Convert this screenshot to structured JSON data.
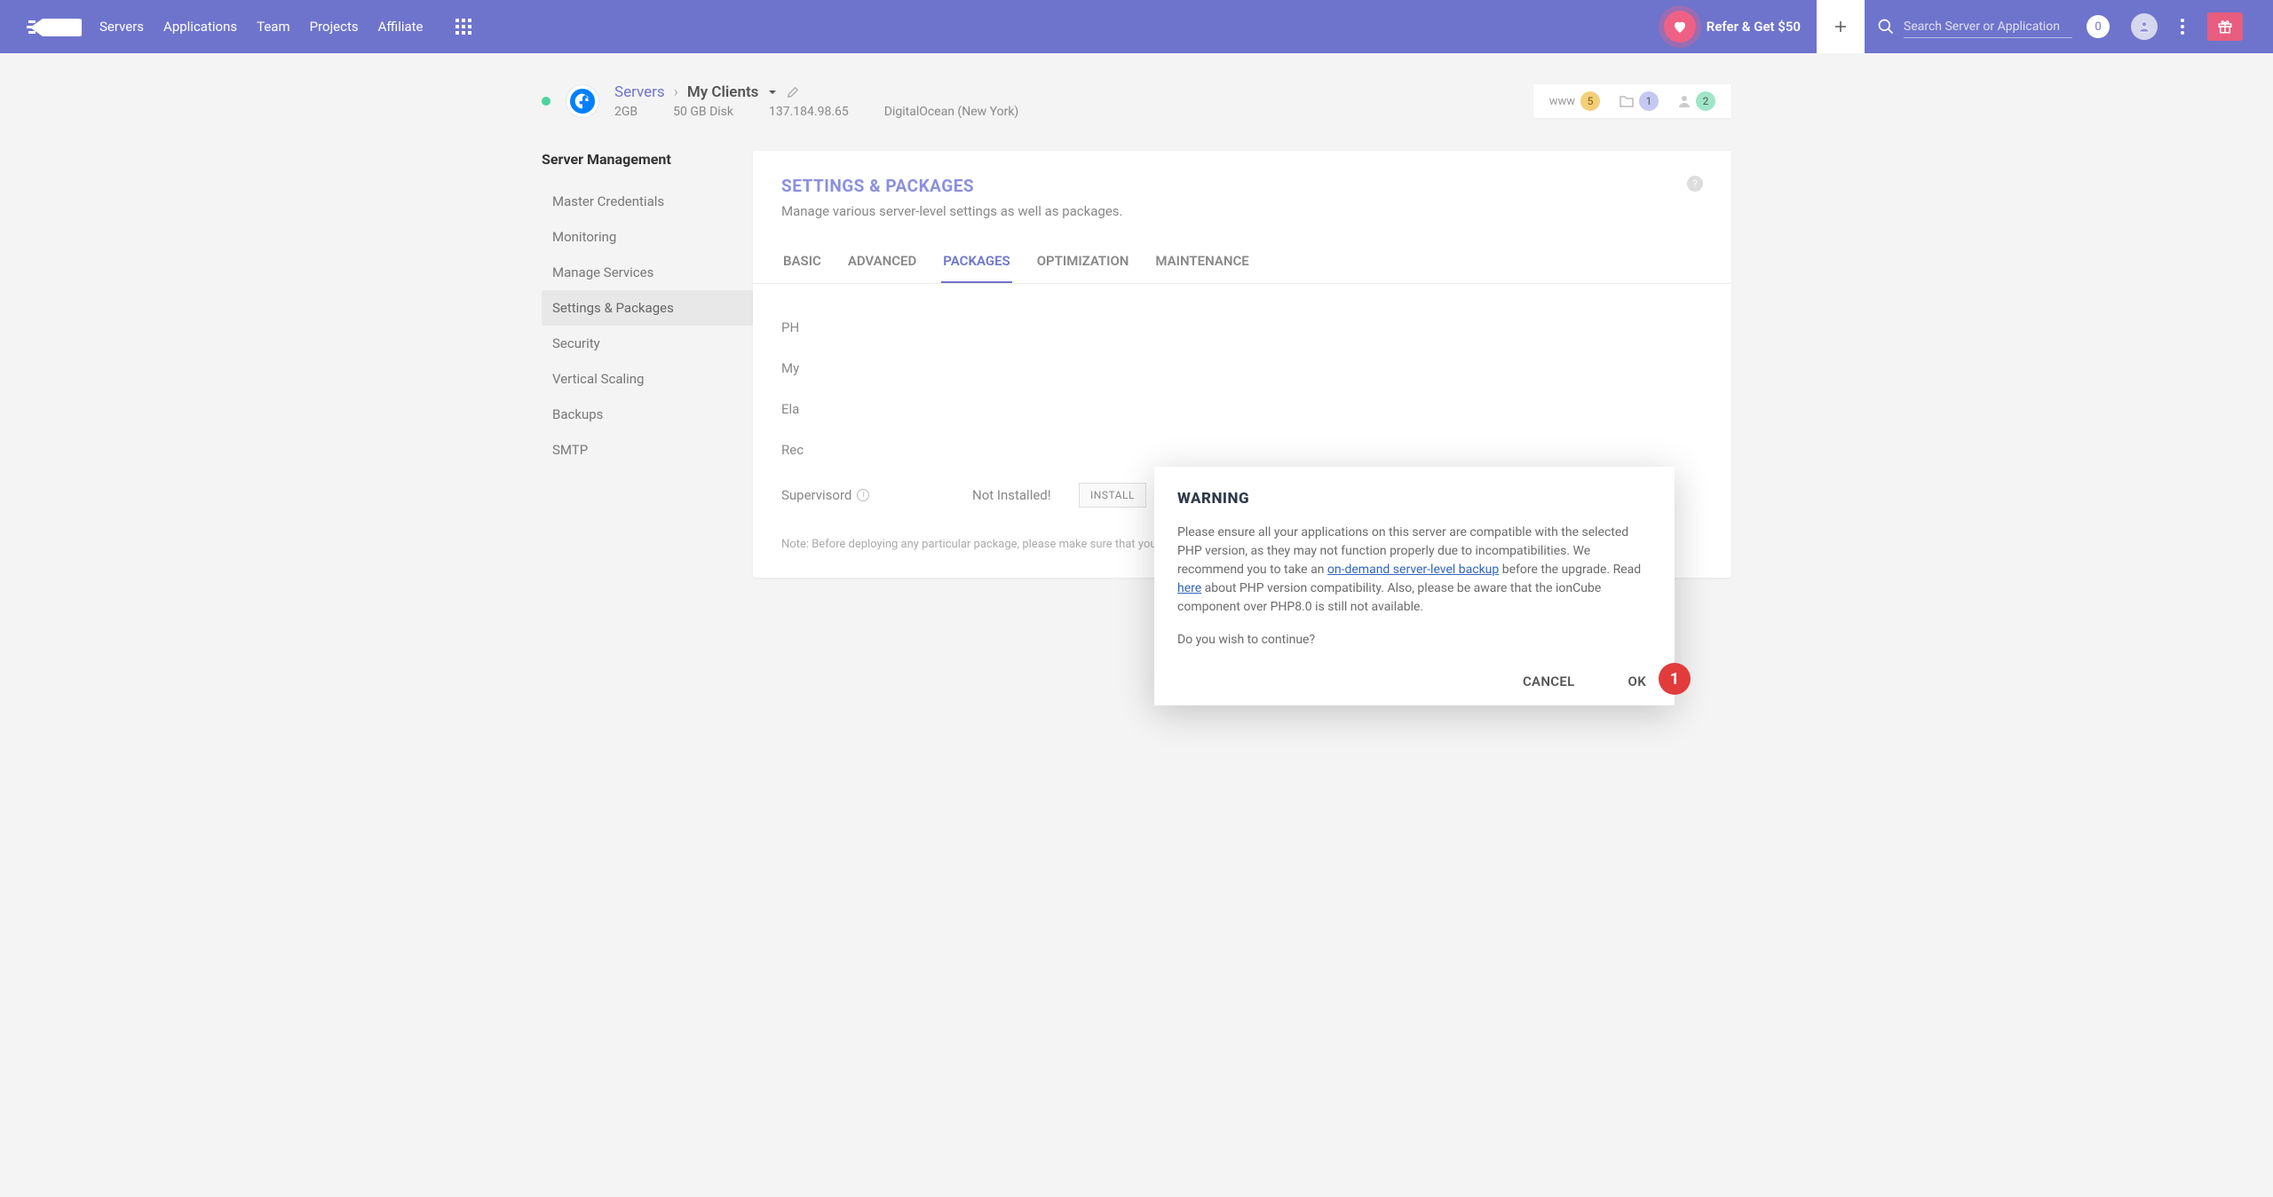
{
  "nav": {
    "links": [
      "Servers",
      "Applications",
      "Team",
      "Projects",
      "Affiliate"
    ],
    "refer": "Refer & Get $50",
    "search_placeholder": "Search Server or Application",
    "notif_count": "0"
  },
  "server": {
    "crumb_root": "Servers",
    "name": "My Clients",
    "ram": "2GB",
    "disk": "50 GB Disk",
    "ip": "137.184.98.65",
    "provider": "DigitalOcean (New York)",
    "badges": {
      "www": "www",
      "www_n": "5",
      "proj_n": "1",
      "users_n": "2"
    }
  },
  "sidebar": {
    "title": "Server Management",
    "items": [
      "Master Credentials",
      "Monitoring",
      "Manage Services",
      "Settings & Packages",
      "Security",
      "Vertical Scaling",
      "Backups",
      "SMTP"
    ],
    "active_index": 3
  },
  "panel": {
    "title": "SETTINGS & PACKAGES",
    "subtitle": "Manage various server-level settings as well as packages.",
    "tabs": [
      "BASIC",
      "ADVANCED",
      "PACKAGES",
      "OPTIMIZATION",
      "MAINTENANCE"
    ],
    "active_tab": 2,
    "rows": [
      {
        "label": "PH",
        "status": "",
        "action": ""
      },
      {
        "label": "My",
        "status": "",
        "action": ""
      },
      {
        "label": "Ela",
        "status": "",
        "action": ""
      },
      {
        "label": "Rec",
        "status": "",
        "action": ""
      },
      {
        "label": "Supervisord",
        "status": "Not Installed!",
        "action": "INSTALL"
      }
    ],
    "note": "Note: Before deploying any particular package, please make sure that your application and its plugins or extensions are compatible."
  },
  "modal": {
    "title": "WARNING",
    "text_before_link1": "Please ensure all your applications on this server are compatible with the selected PHP version, as they may not function properly due to incompatibilities. We recommend you to take an ",
    "link1": "on-demand server-level backup",
    "text_mid": " before the upgrade. Read ",
    "link2": "here",
    "text_after": " about PHP version compatibility. Also, please be aware that the ionCube component over PHP8.0 is still not available.",
    "question": "Do you wish to continue?",
    "cancel": "CANCEL",
    "ok": "OK",
    "annotation": "1"
  }
}
